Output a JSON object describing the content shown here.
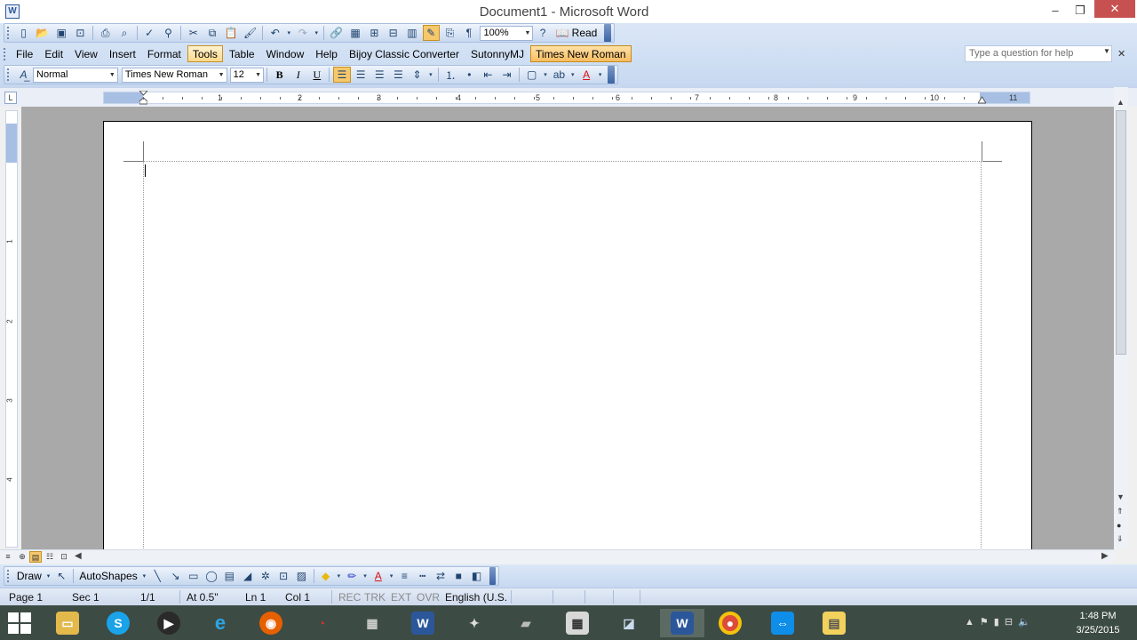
{
  "window": {
    "title": "Document1 - Microsoft Word",
    "app_icon": "word-doc-icon",
    "min_glyph": "–",
    "max_glyph": "❐",
    "close_glyph": "✕"
  },
  "standard_toolbar": {
    "zoom": "100%",
    "read_label": "Read"
  },
  "menu": {
    "items": [
      "File",
      "Edit",
      "View",
      "Insert",
      "Format",
      "Tools",
      "Table",
      "Window",
      "Help",
      "Bijoy Classic Converter",
      "SutonnyMJ",
      "Times New Roman"
    ],
    "hovered": "Tools",
    "highlighted": "Times New Roman",
    "help_placeholder": "Type a question for help"
  },
  "formatting_toolbar": {
    "style": "Normal",
    "font": "Times New Roman",
    "size": "12",
    "bold": "B",
    "italic": "I",
    "underline": "U"
  },
  "ruler": {
    "numbers": [
      "1",
      "2",
      "3",
      "4",
      "5",
      "6",
      "7",
      "8",
      "9",
      "10",
      "11"
    ],
    "vertical_numbers": [
      "1",
      "2",
      "3",
      "4"
    ]
  },
  "drawing_toolbar": {
    "draw_label": "Draw",
    "autoshapes_label": "AutoShapes"
  },
  "status_bar": {
    "page": "Page  1",
    "sec": "Sec  1",
    "pages": "1/1",
    "at": "At  0.5\"",
    "ln": "Ln  1",
    "col": "Col  1",
    "rec": "REC",
    "trk": "TRK",
    "ext": "EXT",
    "ovr": "OVR",
    "language": "English (U.S."
  },
  "taskbar": {
    "apps": [
      "file-explorer-icon",
      "skype-icon",
      "media-player-icon",
      "internet-explorer-icon",
      "firefox-icon",
      "app-icon",
      "network-icon",
      "word-icon",
      "paint-icon",
      "projector-icon",
      "calculator-icon",
      "eraser-icon",
      "word-active-icon",
      "chrome-icon",
      "teamviewer-icon",
      "notes-icon"
    ],
    "time": "1:48 PM",
    "date": "3/25/2015"
  },
  "colors": {
    "close_button": "#c75050",
    "accent": "#2b579a",
    "highlight": "#f6c86b"
  }
}
